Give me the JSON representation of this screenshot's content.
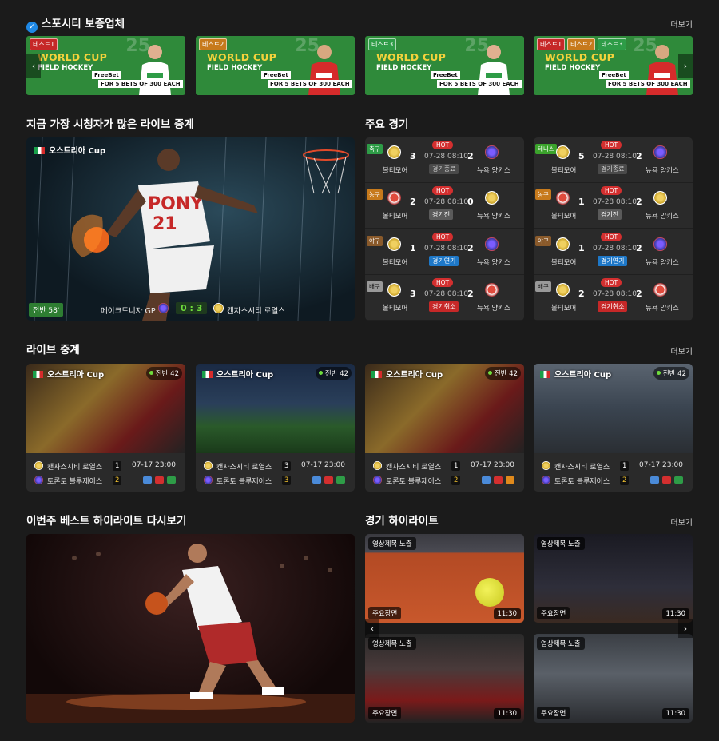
{
  "sponsors": {
    "title": "스포시티 보증업체",
    "more": "더보기",
    "banners": [
      {
        "tags": [
          "테스트1"
        ],
        "headline": "WORLD CUP",
        "sub": "FIELD HOCKEY",
        "num": "25",
        "freebet": "FreeBet",
        "bets": "FOR 5 BETS OF 300 EACH"
      },
      {
        "tags": [
          "테스트2"
        ],
        "headline": "WORLD CUP",
        "sub": "FIELD HOCKEY",
        "num": "25",
        "freebet": "FreeBet",
        "bets": "FOR 5 BETS OF 300 EACH"
      },
      {
        "tags": [
          "테스트3"
        ],
        "headline": "WORLD CUP",
        "sub": "FIELD HOCKEY",
        "num": "25",
        "freebet": "FreeBet",
        "bets": "FOR 5 BETS OF 300 EACH"
      },
      {
        "tags": [
          "테스트1",
          "테스트2",
          "테스트3"
        ],
        "headline": "WORLD CUP",
        "sub": "FIELD HOCKEY",
        "num": "25",
        "freebet": "FreeBet",
        "bets": "FOR 5 BETS OF 300 EACH"
      }
    ]
  },
  "most_watched": {
    "title": "지금 가장 시청자가 많은 라이브 중계",
    "league": "오스트리아 Cup",
    "period": "전반 58'",
    "home": "메이크도니자 GP",
    "score": "0 : 3",
    "away": "캔자스시티 로열스"
  },
  "key_matches": {
    "title": "주요 경기",
    "hot": "HOT",
    "cols": [
      [
        {
          "sport": "축구",
          "home_score": "3",
          "away_score": "2",
          "date": "07-28 08:10",
          "status": "경기종료",
          "status_type": "end",
          "home": "볼티모어",
          "away": "뉴욕 양키스"
        },
        {
          "sport": "농구",
          "home_score": "2",
          "away_score": "0",
          "date": "07-28 08:10",
          "status": "경기전",
          "status_type": "play",
          "home": "볼티모어",
          "away": "뉴욕 양키스"
        },
        {
          "sport": "야구",
          "home_score": "1",
          "away_score": "2",
          "date": "07-28 08:10",
          "status": "경기연기",
          "status_type": "ext",
          "home": "볼티모어",
          "away": "뉴욕 양키스"
        },
        {
          "sport": "배구",
          "home_score": "3",
          "away_score": "2",
          "date": "07-28 08:10",
          "status": "경기취소",
          "status_type": "can",
          "home": "볼티모어",
          "away": "뉴욕 양키스"
        }
      ],
      [
        {
          "sport": "테니스",
          "home_score": "5",
          "away_score": "2",
          "date": "07-28 08:10",
          "status": "경기종료",
          "status_type": "end",
          "home": "볼티모어",
          "away": "뉴욕 양키스"
        },
        {
          "sport": "농구",
          "home_score": "1",
          "away_score": "2",
          "date": "07-28 08:10",
          "status": "경기전",
          "status_type": "play",
          "home": "볼티모어",
          "away": "뉴욕 양키스"
        },
        {
          "sport": "야구",
          "home_score": "1",
          "away_score": "2",
          "date": "07-28 08:10",
          "status": "경기연기",
          "status_type": "ext",
          "home": "볼티모어",
          "away": "뉴욕 양키스"
        },
        {
          "sport": "배구",
          "home_score": "2",
          "away_score": "2",
          "date": "07-28 08:10",
          "status": "경기취소",
          "status_type": "can",
          "home": "볼티모어",
          "away": "뉴욕 양키스"
        }
      ]
    ]
  },
  "live": {
    "title": "라이브 중계",
    "more": "더보기",
    "cards": [
      {
        "league": "오스트리아 Cup",
        "period": "전반 42",
        "home": "캔자스시티 로열스",
        "home_score": "1",
        "away": "토론토 블루제이스",
        "away_score": "2",
        "time": "07-17 23:00"
      },
      {
        "league": "오스트리아 Cup",
        "period": "전반 42",
        "home": "캔자스시티 로열스",
        "home_score": "3",
        "away": "토론토 블루제이스",
        "away_score": "3",
        "time": "07-17 23:00"
      },
      {
        "league": "오스트리아 Cup",
        "period": "전반 42",
        "home": "캔자스시티 로열스",
        "home_score": "1",
        "away": "토론토 블루제이스",
        "away_score": "2",
        "time": "07-17 23:00"
      },
      {
        "league": "오스트리아 Cup",
        "period": "전반 42",
        "home": "캔자스시티 로열스",
        "home_score": "1",
        "away": "토론토 블루제이스",
        "away_score": "2",
        "time": "07-17 23:00"
      }
    ]
  },
  "best_highlight": {
    "title": "이번주 베스트 하이라이트 다시보기"
  },
  "highlights": {
    "title": "경기 하이라이트",
    "more": "더보기",
    "cards": [
      {
        "tag": "영상제목 노출",
        "label": "주요장면",
        "duration": "11:30"
      },
      {
        "tag": "영상제목 노출",
        "label": "주요장면",
        "duration": "11:30"
      },
      {
        "tag": "영상제목 노출",
        "label": "주요장면",
        "duration": "11:30"
      },
      {
        "tag": "영상제목 노출",
        "label": "주요장면",
        "duration": "11:30"
      }
    ]
  },
  "colors": {
    "bg": "#1b1b1b",
    "card": "#2a2a2a",
    "banner": "#2f8a3a",
    "hot": "#d32f2f",
    "accent_blue": "#1e78c8",
    "score_green": "#6fdc3c"
  }
}
